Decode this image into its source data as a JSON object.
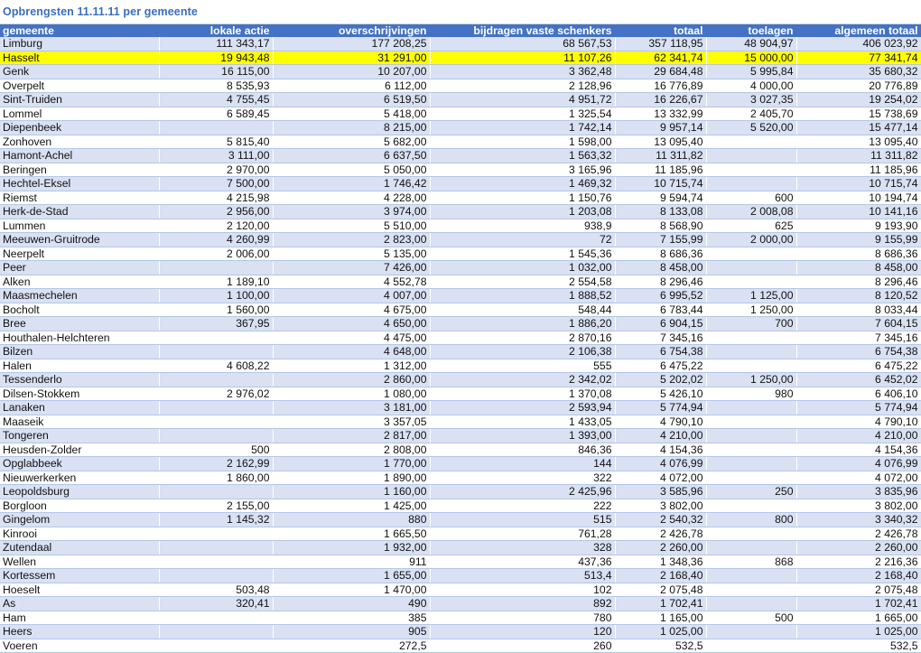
{
  "sheet": {
    "title": "Opbrengsten 11.11.11 per gemeente",
    "headers": [
      "gemeente",
      "lokale actie",
      "overschrijvingen",
      "bijdragen vaste schenkers",
      "totaal",
      "toelagen",
      "algemeen totaal"
    ],
    "highlight_color": "#ffff00",
    "header_color": "#4472c4",
    "band_color": "#d9e1f2",
    "highlight_row": "Hasselt",
    "rows": [
      [
        "Limburg",
        "111 343,17",
        "177 208,25",
        "68 567,53",
        "357 118,95",
        "48 904,97",
        "406 023,92"
      ],
      [
        "Hasselt",
        "19 943,48",
        "31 291,00",
        "11 107,26",
        "62 341,74",
        "15 000,00",
        "77 341,74"
      ],
      [
        "Genk",
        "16 115,00",
        "10 207,00",
        "3 362,48",
        "29 684,48",
        "5 995,84",
        "35 680,32"
      ],
      [
        "Overpelt",
        "8 535,93",
        "6 112,00",
        "2 128,96",
        "16 776,89",
        "4 000,00",
        "20 776,89"
      ],
      [
        "Sint-Truiden",
        "4 755,45",
        "6 519,50",
        "4 951,72",
        "16 226,67",
        "3 027,35",
        "19 254,02"
      ],
      [
        "Lommel",
        "6 589,45",
        "5 418,00",
        "1 325,54",
        "13 332,99",
        "2 405,70",
        "15 738,69"
      ],
      [
        "Diepenbeek",
        "",
        "8 215,00",
        "1 742,14",
        "9 957,14",
        "5 520,00",
        "15 477,14"
      ],
      [
        "Zonhoven",
        "5 815,40",
        "5 682,00",
        "1 598,00",
        "13 095,40",
        "",
        "13 095,40"
      ],
      [
        "Hamont-Achel",
        "3 111,00",
        "6 637,50",
        "1 563,32",
        "11 311,82",
        "",
        "11 311,82"
      ],
      [
        "Beringen",
        "2 970,00",
        "5 050,00",
        "3 165,96",
        "11 185,96",
        "",
        "11 185,96"
      ],
      [
        "Hechtel-Eksel",
        "7 500,00",
        "1 746,42",
        "1 469,32",
        "10 715,74",
        "",
        "10 715,74"
      ],
      [
        "Riemst",
        "4 215,98",
        "4 228,00",
        "1 150,76",
        "9 594,74",
        "600",
        "10 194,74"
      ],
      [
        "Herk-de-Stad",
        "2 956,00",
        "3 974,00",
        "1 203,08",
        "8 133,08",
        "2 008,08",
        "10 141,16"
      ],
      [
        "Lummen",
        "2 120,00",
        "5 510,00",
        "938,9",
        "8 568,90",
        "625",
        "9 193,90"
      ],
      [
        "Meeuwen-Gruitrode",
        "4 260,99",
        "2 823,00",
        "72",
        "7 155,99",
        "2 000,00",
        "9 155,99"
      ],
      [
        "Neerpelt",
        "2 006,00",
        "5 135,00",
        "1 545,36",
        "8 686,36",
        "",
        "8 686,36"
      ],
      [
        "Peer",
        "",
        "7 426,00",
        "1 032,00",
        "8 458,00",
        "",
        "8 458,00"
      ],
      [
        "Alken",
        "1 189,10",
        "4 552,78",
        "2 554,58",
        "8 296,46",
        "",
        "8 296,46"
      ],
      [
        "Maasmechelen",
        "1 100,00",
        "4 007,00",
        "1 888,52",
        "6 995,52",
        "1 125,00",
        "8 120,52"
      ],
      [
        "Bocholt",
        "1 560,00",
        "4 675,00",
        "548,44",
        "6 783,44",
        "1 250,00",
        "8 033,44"
      ],
      [
        "Bree",
        "367,95",
        "4 650,00",
        "1 886,20",
        "6 904,15",
        "700",
        "7 604,15"
      ],
      [
        "Houthalen-Helchteren",
        "",
        "4 475,00",
        "2 870,16",
        "7 345,16",
        "",
        "7 345,16"
      ],
      [
        "Bilzen",
        "",
        "4 648,00",
        "2 106,38",
        "6 754,38",
        "",
        "6 754,38"
      ],
      [
        "Halen",
        "4 608,22",
        "1 312,00",
        "555",
        "6 475,22",
        "",
        "6 475,22"
      ],
      [
        "Tessenderlo",
        "",
        "2 860,00",
        "2 342,02",
        "5 202,02",
        "1 250,00",
        "6 452,02"
      ],
      [
        "Dilsen-Stokkem",
        "2 976,02",
        "1 080,00",
        "1 370,08",
        "5 426,10",
        "980",
        "6 406,10"
      ],
      [
        "Lanaken",
        "",
        "3 181,00",
        "2 593,94",
        "5 774,94",
        "",
        "5 774,94"
      ],
      [
        "Maaseik",
        "",
        "3 357,05",
        "1 433,05",
        "4 790,10",
        "",
        "4 790,10"
      ],
      [
        "Tongeren",
        "",
        "2 817,00",
        "1 393,00",
        "4 210,00",
        "",
        "4 210,00"
      ],
      [
        "Heusden-Zolder",
        "500",
        "2 808,00",
        "846,36",
        "4 154,36",
        "",
        "4 154,36"
      ],
      [
        "Opglabbeek",
        "2 162,99",
        "1 770,00",
        "144",
        "4 076,99",
        "",
        "4 076,99"
      ],
      [
        "Nieuwerkerken",
        "1 860,00",
        "1 890,00",
        "322",
        "4 072,00",
        "",
        "4 072,00"
      ],
      [
        "Leopoldsburg",
        "",
        "1 160,00",
        "2 425,96",
        "3 585,96",
        "250",
        "3 835,96"
      ],
      [
        "Borgloon",
        "2 155,00",
        "1 425,00",
        "222",
        "3 802,00",
        "",
        "3 802,00"
      ],
      [
        "Gingelom",
        "1 145,32",
        "880",
        "515",
        "2 540,32",
        "800",
        "3 340,32"
      ],
      [
        "Kinrooi",
        "",
        "1 665,50",
        "761,28",
        "2 426,78",
        "",
        "2 426,78"
      ],
      [
        "Zutendaal",
        "",
        "1 932,00",
        "328",
        "2 260,00",
        "",
        "2 260,00"
      ],
      [
        "Wellen",
        "",
        "911",
        "437,36",
        "1 348,36",
        "868",
        "2 216,36"
      ],
      [
        "Kortessem",
        "",
        "1 655,00",
        "513,4",
        "2 168,40",
        "",
        "2 168,40"
      ],
      [
        "Hoeselt",
        "503,48",
        "1 470,00",
        "102",
        "2 075,48",
        "",
        "2 075,48"
      ],
      [
        "As",
        "320,41",
        "490",
        "892",
        "1 702,41",
        "",
        "1 702,41"
      ],
      [
        "Ham",
        "",
        "385",
        "780",
        "1 165,00",
        "500",
        "1 665,00"
      ],
      [
        "Heers",
        "",
        "905",
        "120",
        "1 025,00",
        "",
        "1 025,00"
      ],
      [
        "Voeren",
        "",
        "272,5",
        "260",
        "532,5",
        "",
        "532,5"
      ]
    ]
  }
}
